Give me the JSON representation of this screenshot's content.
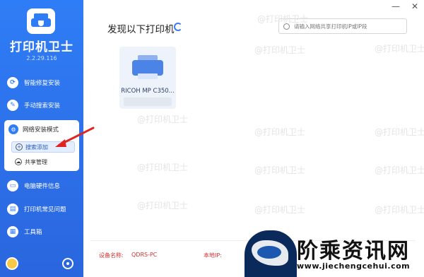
{
  "app": {
    "title": "打印机卫士",
    "version": "2.2.29.116"
  },
  "sidebar": {
    "items": [
      {
        "label": "智能修复安装",
        "icon": "repair-icon"
      },
      {
        "label": "手动搜索安装",
        "icon": "wrench-icon"
      },
      {
        "label": "网络安装模式",
        "icon": "network-icon"
      },
      {
        "label": "电脑硬件信息",
        "icon": "monitor-icon"
      },
      {
        "label": "打印机常见问题",
        "icon": "printer-icon"
      },
      {
        "label": "工具箱",
        "icon": "toolbox-icon"
      }
    ],
    "sub_items": [
      {
        "label": "搜索添加",
        "icon": "search-add-icon"
      },
      {
        "label": "共享管理",
        "icon": "cloud-icon"
      }
    ]
  },
  "main": {
    "title": "发现以下打印机",
    "search_placeholder": "请输入网络共享打印机IP或IP段",
    "printers": [
      {
        "name": "RICOH MP C350..."
      }
    ]
  },
  "watermark": "@打印机卫士",
  "footer": {
    "device_label": "设备名称:",
    "device_value": "QDRS-PC",
    "ip_label": "本地IP:"
  },
  "badge": {
    "title": "阶乘资讯网",
    "url": "www.jiechengcehui.com"
  },
  "colors": {
    "sidebar": "#2f7df6",
    "accent": "#3a7bef",
    "annotation_arrow": "#e02424",
    "footer_text": "#d93030"
  }
}
